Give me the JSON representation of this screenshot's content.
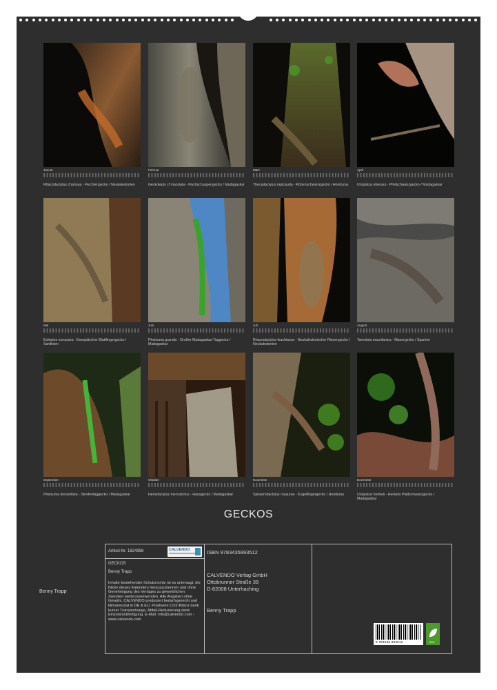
{
  "months": [
    {
      "month": "Januar",
      "caption": "Rhacodactylus chahoua - Flechtengecko / Neukaledonien"
    },
    {
      "month": "Februar",
      "caption": "Geckolepis cf maculata - Fischschuppengecko / Madagaskar"
    },
    {
      "month": "März",
      "caption": "Thecadactylus rapicauda - Rübenschwanzgecko / Honduras"
    },
    {
      "month": "April",
      "caption": "Uroplatus ebenaui - Pfeilschwanzgecko / Madagaskar"
    },
    {
      "month": "Mai",
      "caption": "Euleptes europaea - Europäischer Blattfingergecko / Sardinien"
    },
    {
      "month": "Juni",
      "caption": "Phelsuma grandis - Großer Madagaskar-Taggecko / Madagaskar"
    },
    {
      "month": "Juli",
      "caption": "Rhacodactylus leachianus - Neukaledonischer Riesengecko / Neukaledonien"
    },
    {
      "month": "August",
      "caption": "Tarentola mauritanica - Mauergecko / Spanien"
    },
    {
      "month": "September",
      "caption": "Phelsuma dorsivittata - Streifentaggecko / Madagaskar"
    },
    {
      "month": "Oktober",
      "caption": "Hemidactylus mercatorius - Hausgecko / Madagaskar"
    },
    {
      "month": "November",
      "caption": "Sphaerodactylus rosaurae - Kugelfingergecko / Honduras"
    },
    {
      "month": "Dezember",
      "caption": "Uroplatus henkeli - Henkels Plattschwanzgecko / Madagaskar"
    }
  ],
  "title": "GECKOS",
  "author": "Benny Trapp",
  "info": {
    "article_no": "Artikel-Nr. 1824998",
    "logo_text": "CALVENDO",
    "title": "GECKOS",
    "author": "Benny Trapp",
    "legal": "Inhalte bestehender Schutzrechte ist es untersagt, die Bilder dieses Kalenders herauszutrennen und ohne Genehmigung des Verlages zu gewerblichen Zwecken weiterzuverwenden. Alle Angaben ohne Gewähr. CALVENDO produziert bedarfsgerecht und klimaneutral in DE & EU. Positivere CO2-Bilanz dank kurzer Transportwege, Abfall-Reduzierung dank Einzelstückfertigung. E-Mail: info@calvendo.com - www.calvendo.com",
    "isbn": "ISBN 9783435993512",
    "publisher": "CALVENDO Verlag GmbH",
    "street": "Ottobrunner Straße 39",
    "city": "D-82008 Unterhaching",
    "publisher_author": "Benny Trapp",
    "barcode_number": "9 783435 993512",
    "eco_label": "eco"
  }
}
